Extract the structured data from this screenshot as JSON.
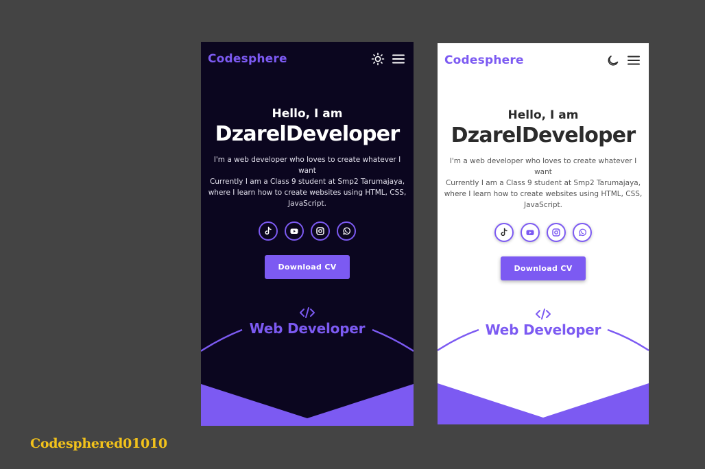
{
  "brand": "Codesphere",
  "hero": {
    "greeting": "Hello, I am",
    "name": "DzarelDeveloper",
    "description_line1": "I'm a web developer who loves to create whatever I want",
    "description_line2": "Currently I am a Class 9 student at Smp2 Tarumajaya, where I learn how to create websites using HTML, CSS, JavaScript."
  },
  "download_button": "Download CV",
  "role_title": "Web Developer",
  "socials": [
    "tiktok-icon",
    "youtube-icon",
    "instagram-icon",
    "whatsapp-icon"
  ],
  "theme_icons": {
    "dark_mode_screen": "sun-icon",
    "light_mode_screen": "moon-icon"
  },
  "colors": {
    "accent": "#7c5af2",
    "dark_background": "#0b061f",
    "light_background": "#ffffff",
    "page_background": "#444444",
    "watermark": "#f2c21b"
  },
  "watermark": "Codesphered01010"
}
